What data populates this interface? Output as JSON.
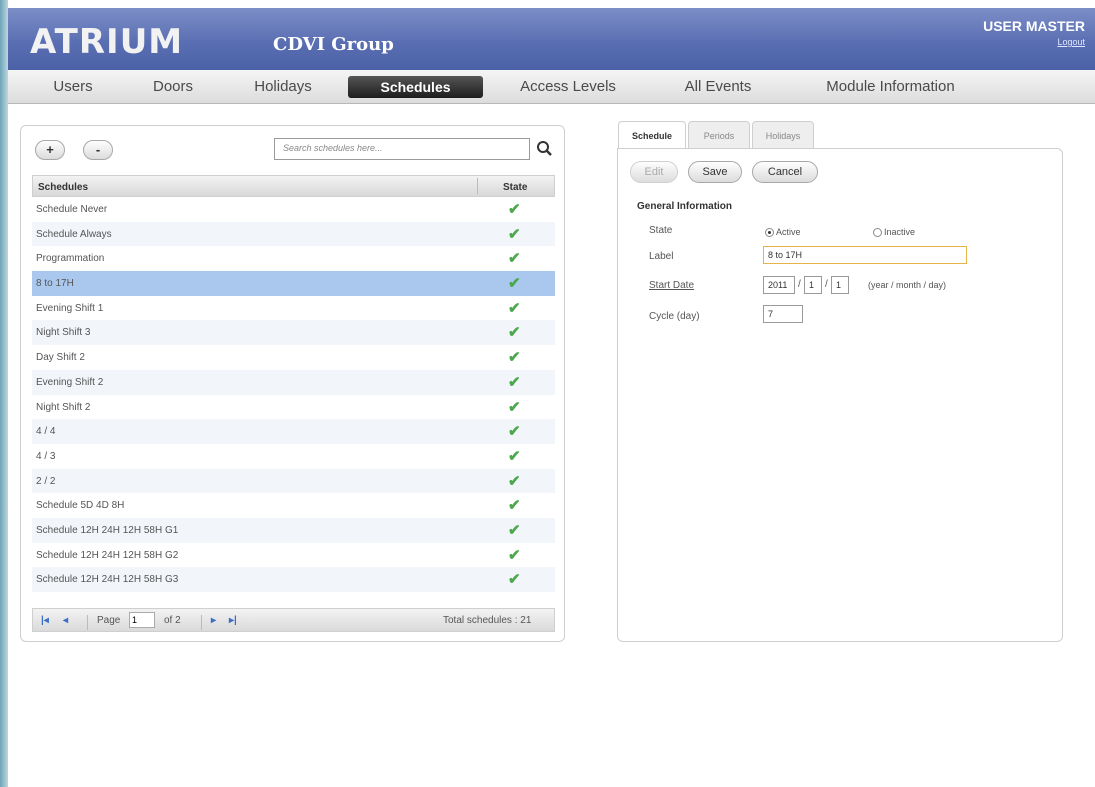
{
  "header": {
    "logo": "ATRIUM",
    "company": "CDVI Group",
    "user": "USER MASTER",
    "logout": "Logout"
  },
  "nav": {
    "users": "Users",
    "doors": "Doors",
    "holidays": "Holidays",
    "schedules": "Schedules",
    "access_levels": "Access Levels",
    "all_events": "All Events",
    "module_info": "Module Information"
  },
  "list": {
    "add_label": "+",
    "remove_label": "-",
    "search_placeholder": "Search schedules here...",
    "col_schedules": "Schedules",
    "col_state": "State",
    "state_icon": "check-icon",
    "rows": [
      {
        "label": "Schedule Never",
        "state": "active"
      },
      {
        "label": "Schedule Always",
        "state": "active"
      },
      {
        "label": "Programmation",
        "state": "active"
      },
      {
        "label": "8 to 17H",
        "state": "active",
        "selected": true
      },
      {
        "label": "Evening Shift 1",
        "state": "active"
      },
      {
        "label": "Night Shift 3",
        "state": "active"
      },
      {
        "label": "Day Shift 2",
        "state": "active"
      },
      {
        "label": "Evening Shift 2",
        "state": "active"
      },
      {
        "label": "Night Shift 2",
        "state": "active"
      },
      {
        "label": "4 / 4",
        "state": "active"
      },
      {
        "label": "4 / 3",
        "state": "active"
      },
      {
        "label": "2 / 2",
        "state": "active"
      },
      {
        "label": "Schedule 5D 4D 8H",
        "state": "active"
      },
      {
        "label": "Schedule 12H 24H 12H 58H G1",
        "state": "active"
      },
      {
        "label": "Schedule 12H 24H 12H 58H G2",
        "state": "active"
      },
      {
        "label": "Schedule 12H 24H 12H 58H G3",
        "state": "active"
      }
    ],
    "pager": {
      "page_label": "Page",
      "page_value": "1",
      "of_label": "of 2",
      "total": "Total schedules : 21"
    }
  },
  "detail": {
    "tabs": [
      "Schedule",
      "Periods",
      "Holidays"
    ],
    "edit": "Edit",
    "save": "Save",
    "cancel": "Cancel",
    "section": "General Information",
    "state_label": "State",
    "active_label": "Active",
    "inactive_label": "Inactive",
    "label_label": "Label",
    "label_value": "8 to 17H",
    "start_date_label": "Start Date",
    "year": "2011",
    "month": "1",
    "day": "1",
    "date_hint": "(year / month / day)",
    "cycle_label": "Cycle (day)",
    "cycle_value": "7"
  },
  "colors": {
    "header_blue": "#5a6fb3",
    "selected_row": "#aac8ee",
    "check_green": "#4ca84c"
  }
}
